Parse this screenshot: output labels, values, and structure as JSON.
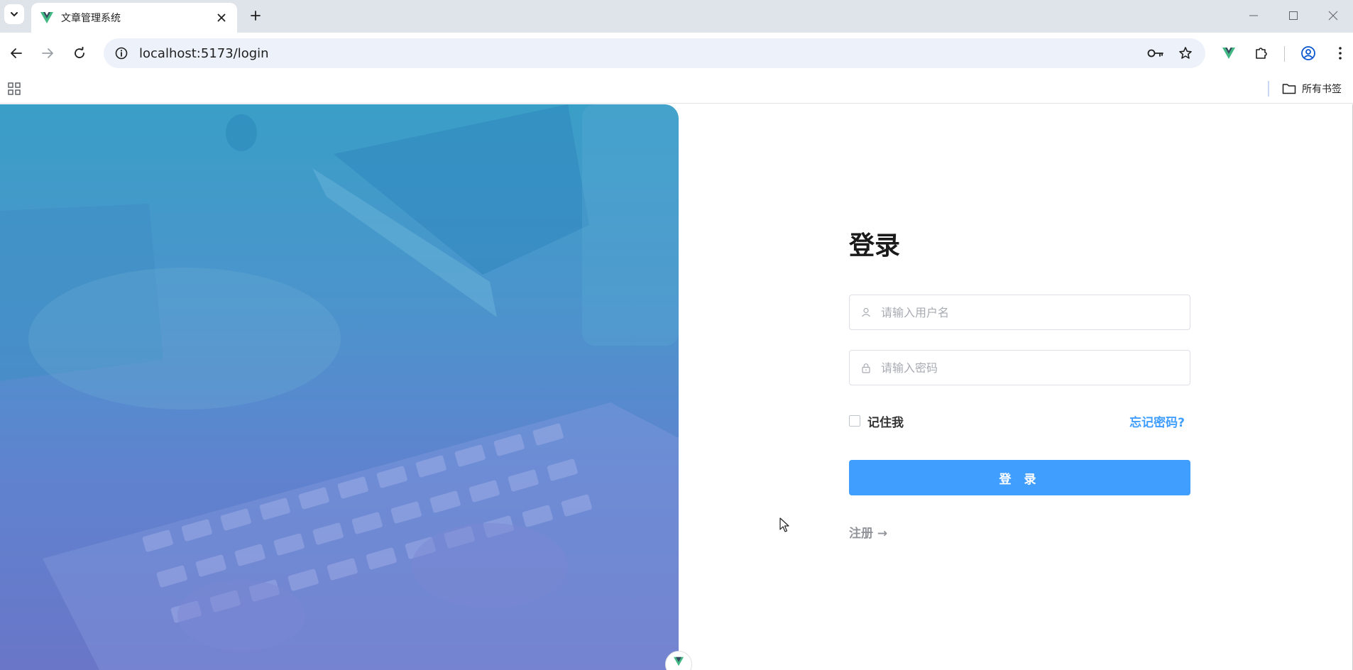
{
  "browser": {
    "tab": {
      "title": "文章管理系统"
    },
    "address_bar": {
      "url": "localhost:5173/login"
    },
    "bookmarks": {
      "all_bookmarks_label": "所有书签"
    }
  },
  "login_page": {
    "title": "登录",
    "username_input": {
      "placeholder": "请输入用户名",
      "value": ""
    },
    "password_input": {
      "placeholder": "请输入密码",
      "value": ""
    },
    "remember_me_label": "记住我",
    "remember_me_checked": false,
    "forgot_password_label": "忘记密码?",
    "login_button_label": "登 录",
    "register_link_label": "注册 →"
  },
  "colors": {
    "primary": "#409eff",
    "panel_top": "#3a9fc7",
    "panel_bottom": "#6a76c8"
  }
}
